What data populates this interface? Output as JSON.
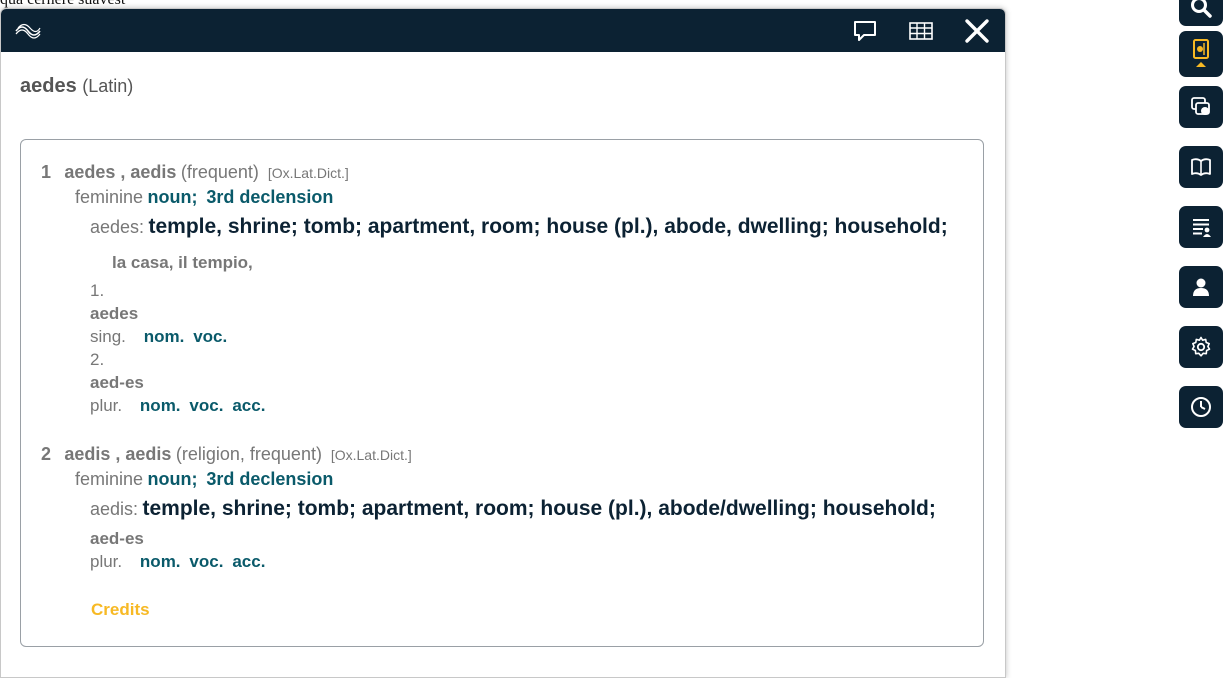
{
  "background_text": "qua cernere suavest",
  "colors": {
    "header": "#0c2233",
    "accent": "#f7b924",
    "teal": "#0a5a6a"
  },
  "header": {
    "logo_icon": "sound-wave-logo-icon",
    "buttons": [
      {
        "name": "comment-button",
        "icon": "speech-bubble-icon"
      },
      {
        "name": "table-button",
        "icon": "grid-table-icon"
      },
      {
        "name": "close-button",
        "icon": "close-icon"
      }
    ]
  },
  "title": {
    "word": "aedes",
    "language": "(Latin)"
  },
  "entries": [
    {
      "number": "1",
      "lemma": "aedes , aedis",
      "note": "(frequent)",
      "source": "[Ox.Lat.Dict.]",
      "gender": "feminine",
      "pos": "noun;",
      "declension": "3rd declension",
      "definition_label": "aedes:",
      "definition": "temple, shrine; tomb; apartment, room; house (pl.), abode, dwelling; household;",
      "translation": "la casa, il tempio,",
      "forms": [
        {
          "index": "1.",
          "form": "aedes",
          "number": "sing.",
          "cases": [
            "nom.",
            "voc."
          ]
        },
        {
          "index": "2.",
          "form": "aed-es",
          "number": "plur.",
          "cases": [
            "nom.",
            "voc.",
            "acc."
          ]
        }
      ]
    },
    {
      "number": "2",
      "lemma": "aedis , aedis",
      "note": "(religion, frequent)",
      "source": "[Ox.Lat.Dict.]",
      "gender": "feminine",
      "pos": "noun;",
      "declension": "3rd declension",
      "definition_label": "aedis:",
      "definition": "temple, shrine; tomb; apartment, room; house (pl.), abode/dwelling; household;",
      "forms": [
        {
          "form": "aed-es",
          "number": "plur.",
          "cases": [
            "nom.",
            "voc.",
            "acc."
          ]
        }
      ]
    }
  ],
  "credits_label": "Credits",
  "sidebar": [
    {
      "name": "search-button",
      "icon": "search-icon"
    },
    {
      "name": "dictionary-button",
      "icon": "book-card-icon"
    },
    {
      "name": "flashcards-button",
      "icon": "cards-icon"
    },
    {
      "name": "reader-button",
      "icon": "open-book-icon"
    },
    {
      "name": "word-list-button",
      "icon": "list-icon"
    },
    {
      "name": "profile-button",
      "icon": "user-icon"
    },
    {
      "name": "settings-button",
      "icon": "gear-icon"
    },
    {
      "name": "history-button",
      "icon": "clock-icon"
    }
  ]
}
